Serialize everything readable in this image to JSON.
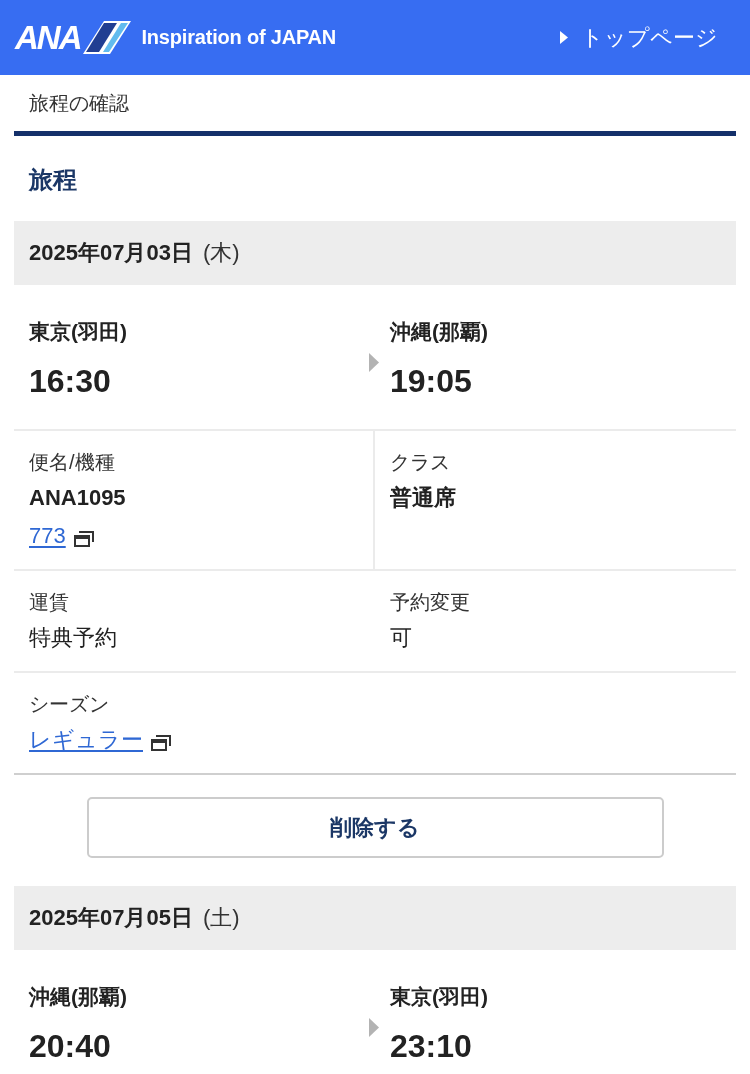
{
  "header": {
    "logo_text": "ANA",
    "tagline": "Inspiration of JAPAN",
    "top_link": "トップページ"
  },
  "page_title": "旅程の確認",
  "section_title": "旅程",
  "segments": [
    {
      "date": "2025年07月03日",
      "weekday": "(木)",
      "origin": {
        "city": "東京(羽田)",
        "time": "16:30"
      },
      "destination": {
        "city": "沖縄(那覇)",
        "time": "19:05"
      },
      "details": [
        {
          "divided": true,
          "cells": [
            {
              "label": "便名/機種",
              "values": [
                {
                  "kind": "strong",
                  "text": "ANA1095"
                },
                {
                  "kind": "link",
                  "text": "773"
                }
              ]
            },
            {
              "label": "クラス",
              "values": [
                {
                  "kind": "strong",
                  "text": "普通席"
                }
              ]
            }
          ]
        },
        {
          "divided": false,
          "cells": [
            {
              "label": "運賃",
              "values": [
                {
                  "kind": "plain",
                  "text": "特典予約"
                }
              ]
            },
            {
              "label": "予約変更",
              "values": [
                {
                  "kind": "plain",
                  "text": "可"
                }
              ]
            }
          ]
        },
        {
          "divided": false,
          "cells": [
            {
              "label": "シーズン",
              "values": [
                {
                  "kind": "link",
                  "text": "レギュラー"
                }
              ]
            }
          ]
        }
      ],
      "delete_button": "削除する"
    },
    {
      "date": "2025年07月05日",
      "weekday": "(土)",
      "origin": {
        "city": "沖縄(那覇)",
        "time": "20:40"
      },
      "destination": {
        "city": "東京(羽田)",
        "time": "23:10"
      }
    }
  ]
}
